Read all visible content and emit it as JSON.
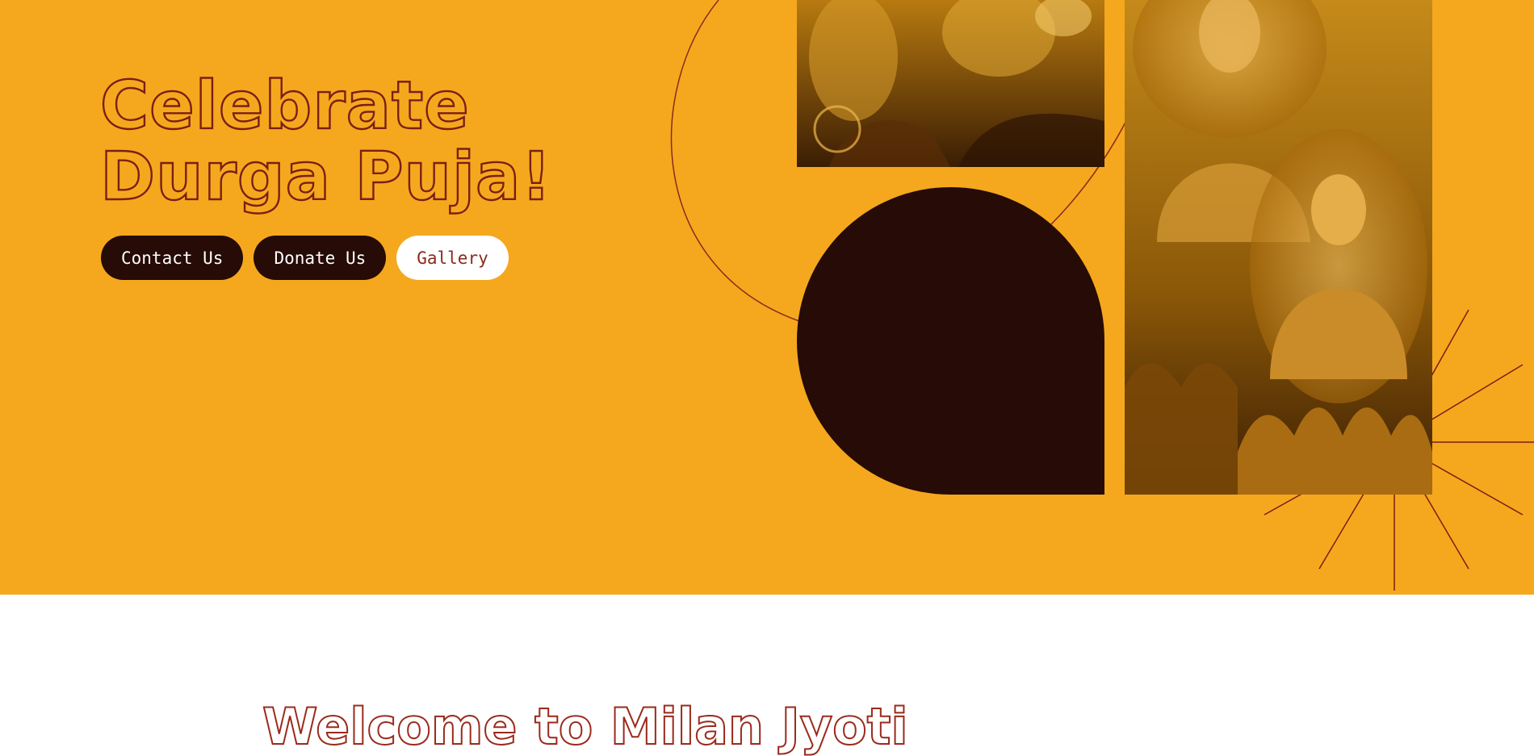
{
  "hero": {
    "title_line1": "Celebrate",
    "title_line2": "Durga Puja!",
    "background_color": "#f5a81d"
  },
  "buttons": {
    "contact": "Contact Us",
    "donate": "Donate Us",
    "gallery": "Gallery"
  },
  "images": {
    "top_tile": "deity-image",
    "tall_tile": "buddha-statues-image"
  },
  "welcome": {
    "heading": "Welcome to Milan Jyoti"
  },
  "colors": {
    "accent": "#f5a81d",
    "dark": "#260b06",
    "maroon": "#7a1f15"
  }
}
